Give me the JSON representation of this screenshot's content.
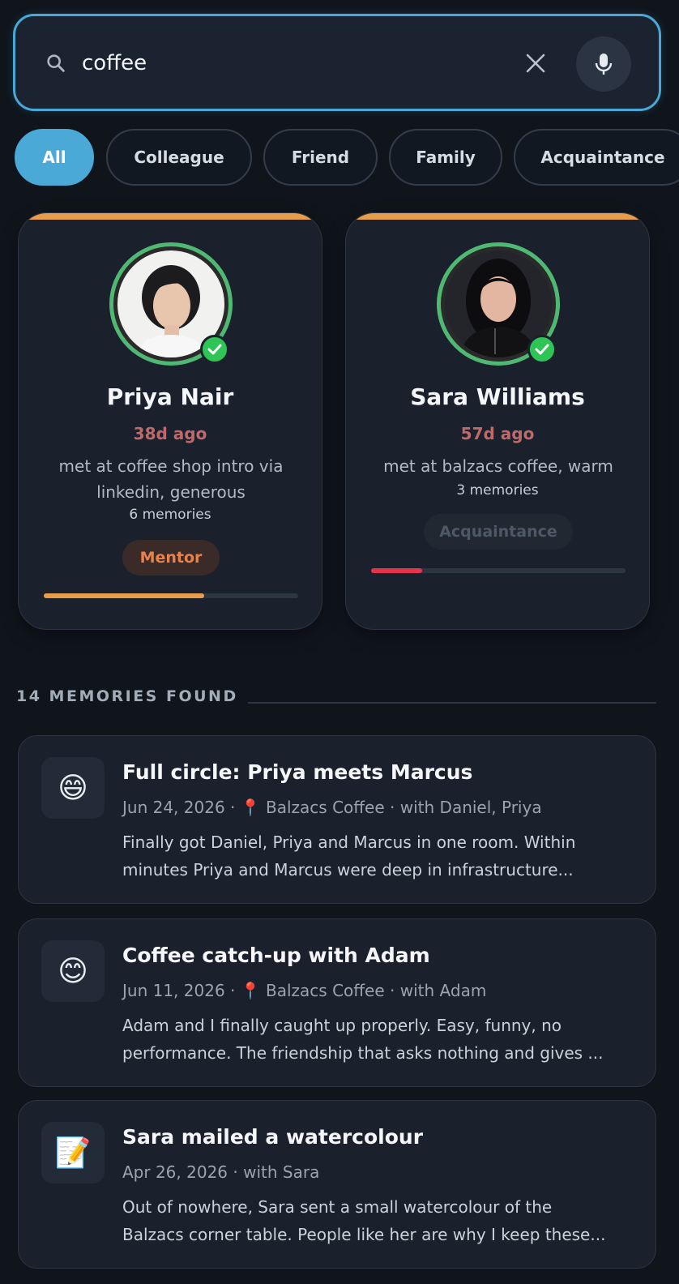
{
  "search": {
    "value": "coffee",
    "icon": "search-icon",
    "clear_icon": "close-icon",
    "mic_icon": "microphone-icon"
  },
  "filters": [
    {
      "label": "All",
      "active": true
    },
    {
      "label": "Colleague",
      "active": false
    },
    {
      "label": "Friend",
      "active": false
    },
    {
      "label": "Family",
      "active": false
    },
    {
      "label": "Acquaintance",
      "active": false
    }
  ],
  "people": [
    {
      "name": "Priya Nair",
      "last_seen": "38d ago",
      "note": "met at coffee shop intro via linkedin, generous",
      "memories": "6 memories",
      "tag": "Mentor",
      "strength": 0.63,
      "strength_color": "#e89d4b",
      "verified": true
    },
    {
      "name": "Sara Williams",
      "last_seen": "57d ago",
      "note": "met at balzacs coffee, warm",
      "memories": "3 memories",
      "tag": "Acquaintance",
      "strength": 0.2,
      "strength_color": "#e5334a",
      "verified": true
    }
  ],
  "memories_section": {
    "title": "14 MEMORIES FOUND"
  },
  "memories": [
    {
      "emoji": "😄",
      "title": "Full circle: Priya meets Marcus",
      "date": "Jun 24, 2026",
      "location": "Balzacs Coffee",
      "with": "with Daniel, Priya",
      "body_line1": "Finally got Daniel, Priya and Marcus in one room. Within",
      "body_line2": "minutes Priya and Marcus were deep in infrastructure..."
    },
    {
      "emoji": "😊",
      "title": "Coffee catch-up with Adam",
      "date": "Jun 11, 2026",
      "location": "Balzacs Coffee",
      "with": "with Adam",
      "body_line1": "Adam and I finally caught up properly. Easy, funny, no",
      "body_line2": "performance. The friendship that asks nothing and gives ..."
    },
    {
      "emoji": "📝",
      "title": "Sara mailed a watercolour",
      "date": "Apr 26, 2026",
      "location": "",
      "with": "with Sara",
      "body_line1": "Out of nowhere, Sara sent a small watercolour of the",
      "body_line2": "Balzacs corner table. People like her are why I keep these..."
    }
  ],
  "colors": {
    "accent": "#4aa9d6",
    "card_top_bar": "#e89d4b",
    "days_ago": "#c0696a",
    "mentor_text": "#e8824a",
    "verified": "#2fc456",
    "ring": "#4fb873"
  }
}
